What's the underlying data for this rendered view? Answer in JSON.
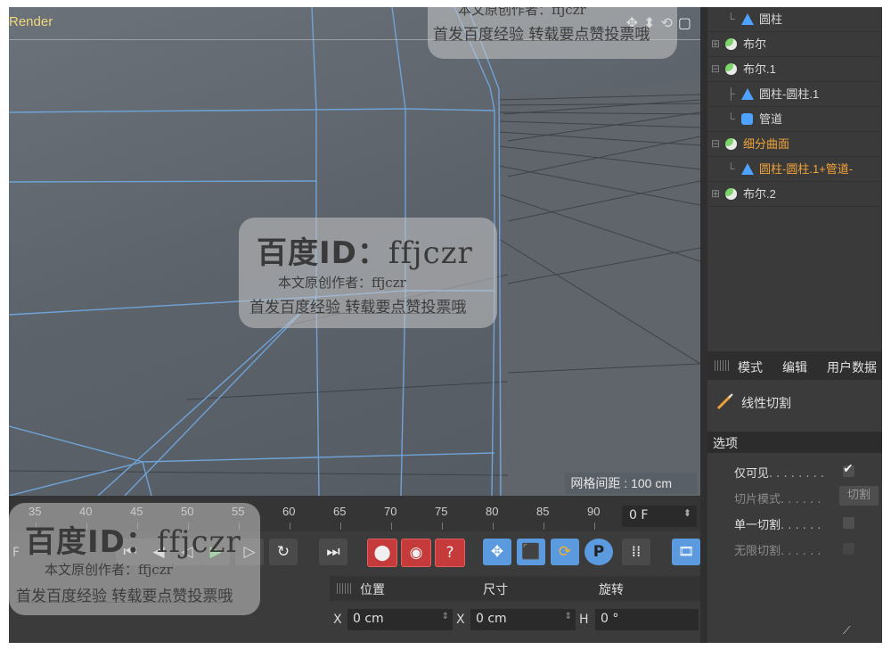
{
  "viewport": {
    "title": "Render",
    "grid_spacing": "网格间距 : 100 cm",
    "nav_icons": [
      "move-view-icon",
      "zoom-view-icon",
      "rotate-view-icon",
      "maximize-view-icon"
    ]
  },
  "object_manager": {
    "items": [
      {
        "label": "圆柱",
        "icon": "cylinder-primitive-icon",
        "tree": "└",
        "indent": 1,
        "selected": false
      },
      {
        "label": "布尔",
        "icon": "boolean-icon",
        "tree": "⊞",
        "indent": 0,
        "selected": false
      },
      {
        "label": "布尔.1",
        "icon": "boolean-icon",
        "tree": "⊟",
        "indent": 0,
        "selected": false
      },
      {
        "label": "圆柱-圆柱.1",
        "icon": "polygon-object-icon",
        "tree": "├",
        "indent": 1,
        "selected": false
      },
      {
        "label": "管道",
        "icon": "tube-icon",
        "tree": "└",
        "indent": 1,
        "selected": false
      },
      {
        "label": "细分曲面",
        "icon": "subdivision-surface-icon",
        "tree": "⊟",
        "indent": 0,
        "selected": true
      },
      {
        "label": "圆柱-圆柱.1+管道-",
        "icon": "polygon-object-icon",
        "tree": "└",
        "indent": 1,
        "selected": true
      },
      {
        "label": "布尔.2",
        "icon": "boolean-icon",
        "tree": "⊞",
        "indent": 0,
        "selected": false
      }
    ]
  },
  "attributes": {
    "tabs": [
      "模式",
      "编辑",
      "用户数据"
    ],
    "tool_name": "线性切割",
    "section": "选项",
    "options": [
      {
        "label": "仅可见",
        "dots": ". . . . . . . .",
        "type": "checkbox",
        "checked": true,
        "enabled": true
      },
      {
        "label": "切片模式",
        "dots": ". . . . . .",
        "type": "button",
        "value": "切割",
        "enabled": false
      },
      {
        "label": "单一切割",
        "dots": ". . . . . .",
        "type": "checkbox",
        "checked": false,
        "enabled": true
      },
      {
        "label": "无限切割",
        "dots": ". . . . . .",
        "type": "checkbox",
        "checked": false,
        "enabled": false
      }
    ]
  },
  "timeline": {
    "ticks": [
      "35",
      "40",
      "45",
      "50",
      "55",
      "60",
      "65",
      "70",
      "75",
      "80",
      "85",
      "90"
    ],
    "current_frame": "0 F",
    "left_label": "F"
  },
  "transport": {
    "buttons": [
      {
        "name": "go-to-start-button",
        "glyph": "⏮",
        "style": "grey"
      },
      {
        "name": "previous-key-button",
        "glyph": "◀",
        "style": "grey"
      },
      {
        "name": "previous-frame-button",
        "glyph": "◁",
        "style": "grey"
      },
      {
        "name": "play-button",
        "glyph": "▶",
        "style": "grey"
      },
      {
        "name": "next-frame-button",
        "glyph": "▷",
        "style": "grey"
      },
      {
        "name": "loop-button",
        "glyph": "↻",
        "style": "grey"
      },
      {
        "name": "go-to-end-button",
        "glyph": "⏭",
        "style": "grey"
      },
      {
        "name": "record-key-button",
        "glyph": "⬤",
        "style": "red"
      },
      {
        "name": "autokey-button",
        "glyph": "◉",
        "style": "red"
      },
      {
        "name": "key-help-button",
        "glyph": "?",
        "style": "red"
      },
      {
        "name": "move-tool-button",
        "glyph": "✥",
        "style": "blue"
      },
      {
        "name": "scale-tool-button",
        "glyph": "⬛",
        "style": "blue"
      },
      {
        "name": "rotate-tool-button",
        "glyph": "⟳",
        "style": "blue"
      },
      {
        "name": "parameter-key-button",
        "glyph": "P",
        "style": "blue"
      },
      {
        "name": "pla-key-button",
        "glyph": "⁞⁞",
        "style": "grey"
      },
      {
        "name": "render-button",
        "glyph": "🎞",
        "style": "blue"
      }
    ]
  },
  "coordinates": {
    "headers": [
      "位置",
      "尺寸",
      "旋转"
    ],
    "x_label": "X",
    "x_position": "0 cm",
    "x_size": "0 cm",
    "h_label": "H",
    "h_rotation": "0 °"
  },
  "watermark": {
    "id_prefix": "百度ID：",
    "id_value": "ffjczr",
    "author": "本文原创作者：ffjczr",
    "note": "首发百度经验 转载要点赞投票哦"
  }
}
